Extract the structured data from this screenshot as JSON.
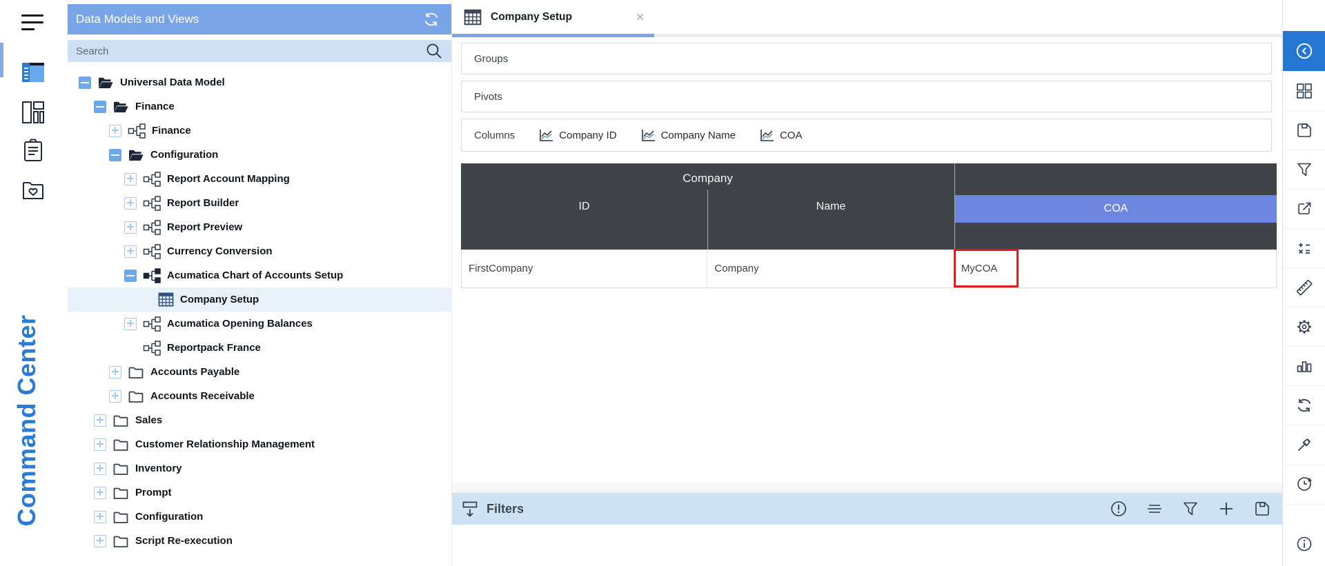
{
  "left_rail": {
    "vertical_text": "Command Center",
    "nav_icons": [
      "data-models-panel",
      "layout-dashboard",
      "clipboard-tasks",
      "favorites-folder"
    ]
  },
  "tree": {
    "title": "Data Models and Views",
    "search_placeholder": "Search",
    "items": [
      {
        "label": "Universal Data Model",
        "level": 0,
        "toggle": "minus",
        "icon": "folder-open"
      },
      {
        "label": "Finance",
        "level": 1,
        "toggle": "minus",
        "icon": "folder-open"
      },
      {
        "label": "Finance",
        "level": 2,
        "toggle": "plus",
        "icon": "model"
      },
      {
        "label": "Configuration",
        "level": 2,
        "toggle": "minus",
        "icon": "folder-open"
      },
      {
        "label": "Report Account Mapping",
        "level": 3,
        "toggle": "plus",
        "icon": "model"
      },
      {
        "label": "Report Builder",
        "level": 3,
        "toggle": "plus",
        "icon": "model"
      },
      {
        "label": "Report Preview",
        "level": 3,
        "toggle": "plus",
        "icon": "model"
      },
      {
        "label": "Currency Conversion",
        "level": 3,
        "toggle": "plus",
        "icon": "model"
      },
      {
        "label": "Acumatica Chart of Accounts Setup",
        "level": 3,
        "toggle": "minus",
        "icon": "model-filled"
      },
      {
        "label": "Company Setup",
        "level": 4,
        "toggle": "none",
        "icon": "grid",
        "selected": true
      },
      {
        "label": "Acumatica Opening Balances",
        "level": 3,
        "toggle": "plus",
        "icon": "model"
      },
      {
        "label": "Reportpack France",
        "level": 3,
        "toggle": "none",
        "icon": "model"
      },
      {
        "label": "Accounts Payable",
        "level": 2,
        "toggle": "plus",
        "icon": "folder-closed"
      },
      {
        "label": "Accounts Receivable",
        "level": 2,
        "toggle": "plus",
        "icon": "folder-closed"
      },
      {
        "label": "Sales",
        "level": 1,
        "toggle": "plus",
        "icon": "folder-closed"
      },
      {
        "label": "Customer Relationship Management",
        "level": 1,
        "toggle": "plus",
        "icon": "folder-closed"
      },
      {
        "label": "Inventory",
        "level": 1,
        "toggle": "plus",
        "icon": "folder-closed"
      },
      {
        "label": "Prompt",
        "level": 1,
        "toggle": "plus",
        "icon": "folder-closed"
      },
      {
        "label": "Configuration",
        "level": 1,
        "toggle": "plus",
        "icon": "folder-closed"
      },
      {
        "label": "Script Re-execution",
        "level": 1,
        "toggle": "plus",
        "icon": "folder-closed"
      }
    ]
  },
  "main": {
    "tab": {
      "label": "Company Setup",
      "close": "✕"
    },
    "zones": {
      "groups_label": "Groups",
      "pivots_label": "Pivots",
      "columns_label": "Columns",
      "chips": [
        "Company ID",
        "Company Name",
        "COA"
      ]
    },
    "table": {
      "group_header": "Company",
      "sub_headers": {
        "id": "ID",
        "name": "Name",
        "coa": "COA"
      },
      "highlighted_column": "COA",
      "rows": [
        [
          "FirstCompany",
          "Company",
          "MyCOA"
        ]
      ],
      "selected_cell_value": "MyCOA"
    },
    "filters": {
      "label": "Filters"
    }
  },
  "right_rail_icons": [
    "collapse-panel",
    "apps-grid",
    "save",
    "filter",
    "share",
    "calculator",
    "ruler",
    "settings",
    "bar-chart",
    "refresh",
    "eyedropper",
    "history",
    "info"
  ],
  "colors": {
    "panel_header_blue": "#7aa4e8",
    "accent_blue": "#2a7bd2",
    "table_header_dark": "#404448",
    "coa_highlight_blue": "#6d86e0",
    "selection_red": "#e01b1b",
    "filters_bar_blue": "#cfe3f6",
    "search_bg": "#cfe0f4",
    "selected_row_bg": "#e9f1fb"
  }
}
